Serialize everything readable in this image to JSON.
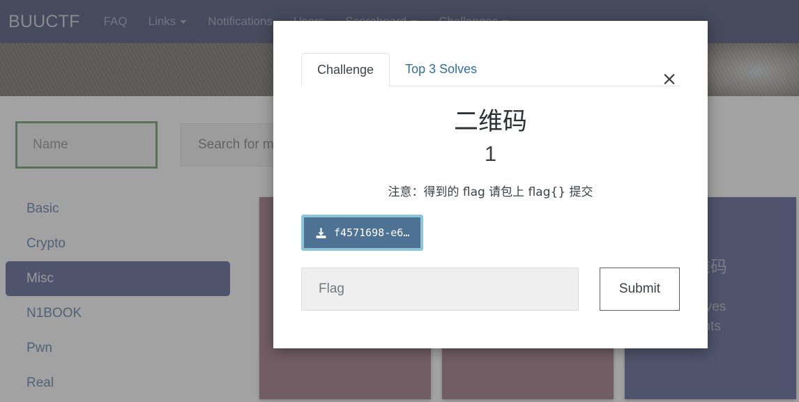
{
  "navbar": {
    "brand": "BUUCTF",
    "items": [
      {
        "label": "FAQ",
        "caret": false
      },
      {
        "label": "Links",
        "caret": true
      },
      {
        "label": "Notifications",
        "caret": false
      },
      {
        "label": "Users",
        "caret": false
      },
      {
        "label": "Scoreboard",
        "caret": true
      },
      {
        "label": "Challenges",
        "caret": true
      }
    ]
  },
  "filters": {
    "name_placeholder": "Name",
    "search_placeholder": "Search for m"
  },
  "sidebar": {
    "items": [
      {
        "label": "Basic",
        "active": false
      },
      {
        "label": "Crypto",
        "active": false
      },
      {
        "label": "Misc",
        "active": true
      },
      {
        "label": "N1BOOK",
        "active": false
      },
      {
        "label": "Pwn",
        "active": false
      },
      {
        "label": "Real",
        "active": false
      }
    ]
  },
  "cards": [
    {
      "state": "solved",
      "title": "",
      "solves": "",
      "points": ""
    },
    {
      "state": "solved",
      "title": "",
      "solves": "",
      "points": ""
    },
    {
      "state": "unsolved",
      "title": "维码",
      "solves": "olves",
      "points": "ints"
    }
  ],
  "modal": {
    "tabs": [
      {
        "label": "Challenge",
        "active": true
      },
      {
        "label": "Top 3 Solves",
        "active": false
      }
    ],
    "close_label": "×",
    "title": "二维码",
    "value": "1",
    "description": "注意：得到的 flag 请包上 flag{} 提交",
    "download_label": "f4571698-e6…",
    "flag_placeholder": "Flag",
    "submit_label": "Submit"
  },
  "colors": {
    "navbar_bg": "#0b1a47",
    "accent_blue": "#27306e",
    "link_blue": "#2f6ea5",
    "solved_card": "#7e4b5c",
    "download_btn": "#4e7293",
    "focus_ring": "#8ac6d8",
    "name_focus_border": "#3e7a42"
  }
}
